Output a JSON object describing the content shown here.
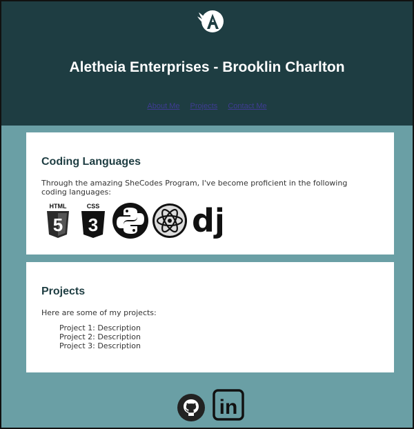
{
  "header": {
    "title": "Aletheia Enterprises - Brooklin Charlton",
    "nav": [
      "About Me",
      "Projects",
      "Contact Me"
    ]
  },
  "coding": {
    "heading": "Coding Languages",
    "text": "Through the amazing SheCodes Program, I've become proficient in the following coding languages:",
    "html_label": "HTML",
    "css_label": "CSS",
    "html_num": "5",
    "css_num": "3",
    "django_label": "dj"
  },
  "projects": {
    "heading": "Projects",
    "text": "Here are some of my projects:",
    "items": [
      "Project 1: Description",
      "Project 2: Description",
      "Project 3: Description"
    ]
  },
  "footer": {
    "linkedin_label": "in"
  },
  "icons": {
    "logo": "winged-a-logo-icon",
    "html": "html5-icon",
    "css": "css3-icon",
    "python": "python-icon",
    "react": "atom-icon",
    "django": "django-icon",
    "github": "github-icon",
    "linkedin": "linkedin-icon"
  },
  "colors": {
    "header_bg": "#1e3d42",
    "page_bg": "#6a9fa5",
    "card_bg": "#ffffff",
    "nav_link": "#3f3c94"
  }
}
